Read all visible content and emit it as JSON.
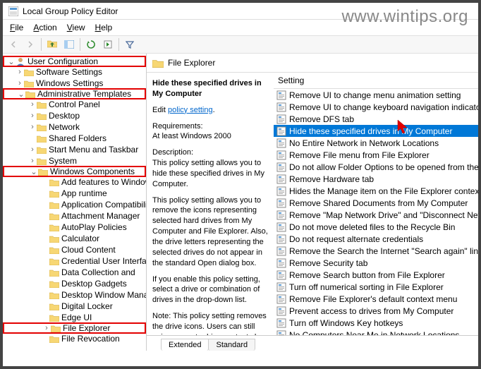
{
  "watermark": "www.wintips.org",
  "window": {
    "title": "Local Group Policy Editor"
  },
  "menu": {
    "file": "File",
    "action": "Action",
    "view": "View",
    "help": "Help"
  },
  "tree": {
    "user_config": "User Configuration",
    "software": "Software Settings",
    "windows_settings": "Windows Settings",
    "admin_templates": "Administrative Templates",
    "control_panel": "Control Panel",
    "desktop": "Desktop",
    "network": "Network",
    "shared_folders": "Shared Folders",
    "start_menu": "Start Menu and Taskbar",
    "system": "System",
    "win_components": "Windows Components",
    "add_features": "Add features to Windows",
    "app_runtime": "App runtime",
    "app_compat": "Application Compatibility",
    "attach_mgr": "Attachment Manager",
    "autoplay": "AutoPlay Policies",
    "calculator": "Calculator",
    "cloud": "Cloud Content",
    "cred_ui": "Credential User Interface",
    "data_collect": "Data Collection and",
    "gadgets": "Desktop Gadgets",
    "dwm": "Desktop Window Manager",
    "digital_locker": "Digital Locker",
    "edge_ui": "Edge UI",
    "file_explorer": "File Explorer",
    "file_revoc": "File Revocation"
  },
  "right_header": "File Explorer",
  "desc": {
    "title": "Hide these specified drives in My Computer",
    "edit_pre": "Edit ",
    "edit_link": "policy setting",
    "req_label": "Requirements:",
    "req_val": "At least Windows 2000",
    "desc_label": "Description:",
    "p1": "This policy setting allows you to hide these specified drives in My Computer.",
    "p2": "This policy setting allows you to remove the icons representing selected hard drives from My Computer and File Explorer. Also, the drive letters representing the selected drives do not appear in the standard Open dialog box.",
    "p3": "If you enable this policy setting, select a drive or combination of drives in the drop-down list.",
    "p4": "Note: This policy setting removes the drive icons. Users can still gain access to drive contents by using other methods, such as by typing"
  },
  "settings_header": "Setting",
  "settings": [
    "Remove UI to change menu animation setting",
    "Remove UI to change keyboard navigation indicator",
    "Remove DFS tab",
    "Hide these specified drives in My Computer",
    "No Entire Network in Network Locations",
    "Remove File menu from File Explorer",
    "Do not allow Folder Options to be opened from the",
    "Remove Hardware tab",
    "Hides the Manage item on the File Explorer context",
    "Remove Shared Documents from My Computer",
    "Remove \"Map Network Drive\" and \"Disconnect Network",
    "Do not move deleted files to the Recycle Bin",
    "Do not request alternate credentials",
    "Remove the Search the Internet \"Search again\" link",
    "Remove Security tab",
    "Remove Search button from File Explorer",
    "Turn off numerical sorting in File Explorer",
    "Remove File Explorer's default context menu",
    "Prevent access to drives from My Computer",
    "Turn off Windows Key hotkeys",
    "No Computers Near Me in Network Locations"
  ],
  "selected_index": 3,
  "tabs": {
    "extended": "Extended",
    "standard": "Standard"
  }
}
